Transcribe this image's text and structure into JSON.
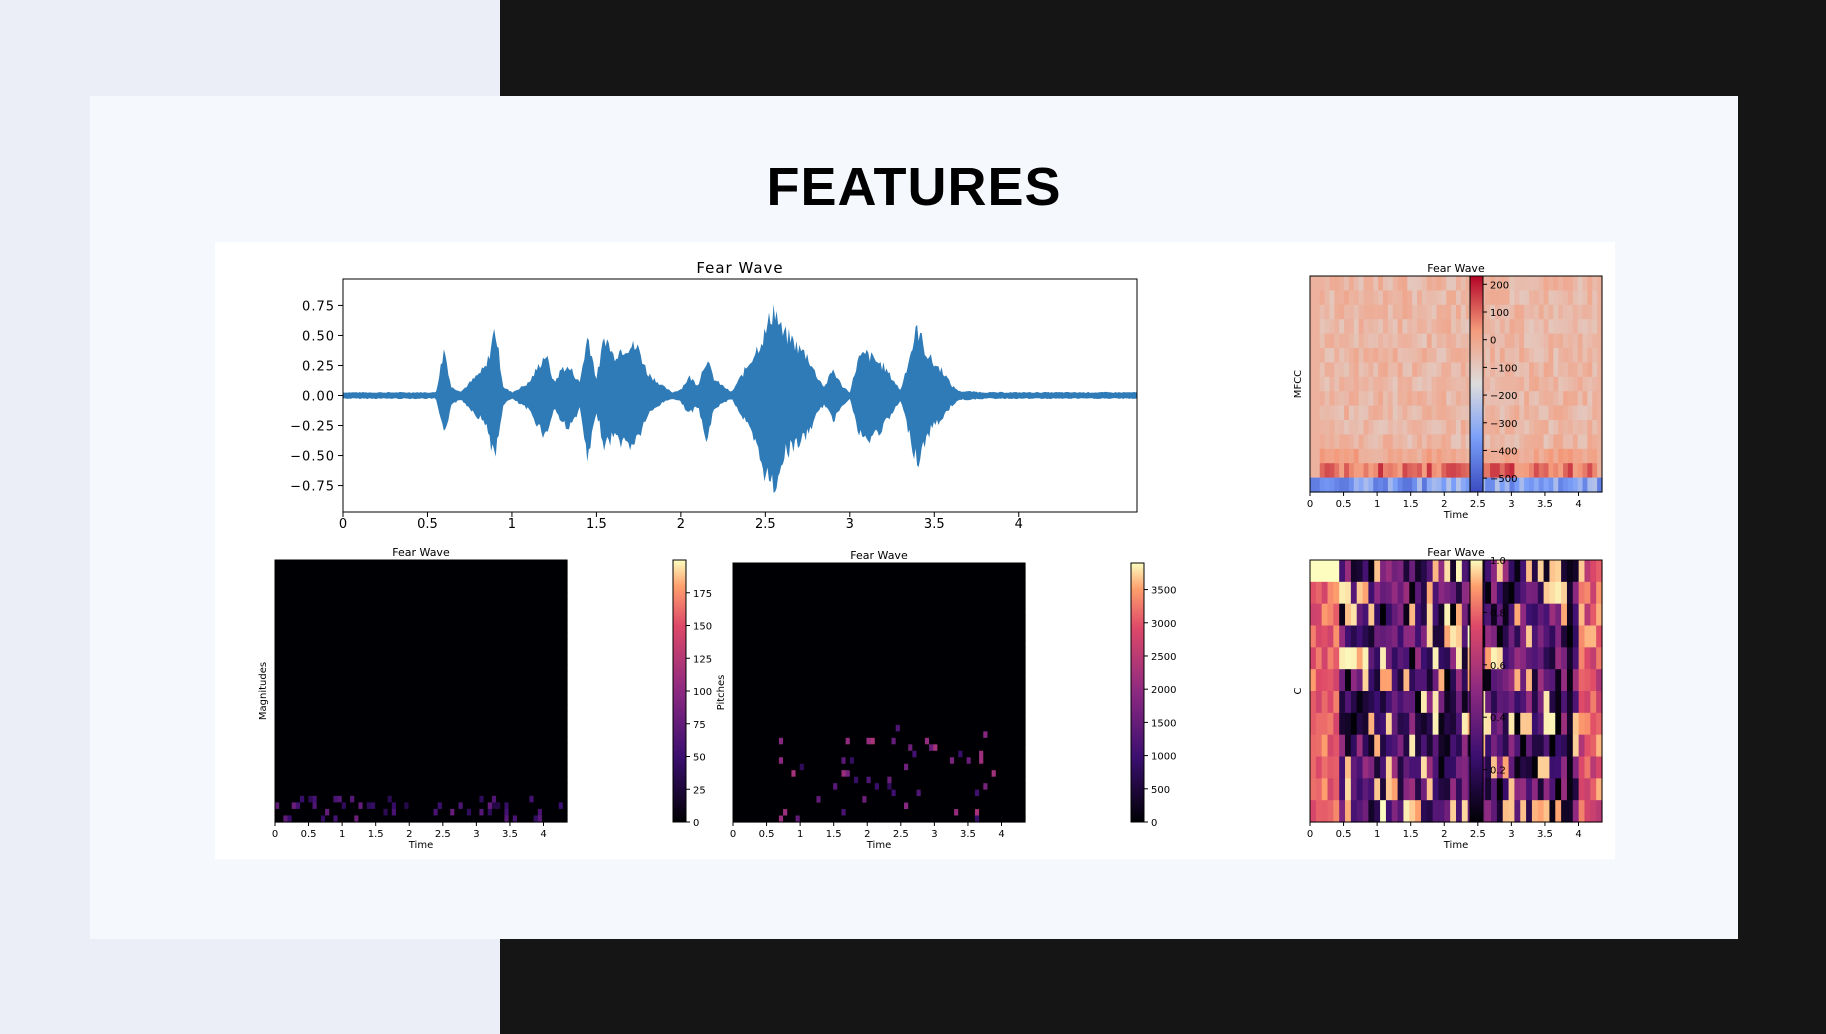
{
  "slide": {
    "title": "FEATURES"
  },
  "colors": {
    "waveform": "#2f7bb7",
    "axes": "#000000",
    "background": "#ffffff"
  },
  "chart_data": [
    {
      "id": "waveform",
      "type": "line",
      "title": "Fear Wave",
      "xlabel": "",
      "ylabel": "",
      "xlim": [
        0,
        4.7
      ],
      "ylim": [
        -0.97,
        0.97
      ],
      "yticks": [
        0.75,
        0.5,
        0.25,
        0.0,
        -0.25,
        -0.5,
        -0.75
      ],
      "ytick_labels": [
        "0.75",
        "0.50",
        "0.25",
        "0.00",
        "−0.25",
        "−0.50",
        "−0.75"
      ],
      "xticks": [
        0,
        0.5,
        1,
        1.5,
        2,
        2.5,
        3,
        3.5,
        4
      ],
      "xtick_labels": [
        "0",
        "0.5",
        "1",
        "1.5",
        "2",
        "2.5",
        "3",
        "3.5",
        "4"
      ],
      "grid": false,
      "envelope": {
        "t": [
          0.0,
          0.55,
          0.6,
          0.64,
          0.7,
          0.85,
          0.9,
          0.95,
          1.0,
          1.1,
          1.2,
          1.25,
          1.3,
          1.35,
          1.4,
          1.45,
          1.5,
          1.55,
          1.6,
          1.65,
          1.7,
          1.75,
          1.8,
          1.85,
          1.9,
          1.95,
          2.0,
          2.05,
          2.1,
          2.15,
          2.2,
          2.3,
          2.4,
          2.5,
          2.55,
          2.6,
          2.65,
          2.7,
          2.75,
          2.8,
          2.85,
          2.9,
          2.95,
          3.0,
          3.05,
          3.1,
          3.2,
          3.3,
          3.4,
          3.45,
          3.5,
          3.55,
          3.6,
          3.65,
          3.7,
          3.8,
          3.9,
          4.0,
          4.1,
          4.7
        ],
        "upper": [
          0.03,
          0.03,
          0.46,
          0.08,
          0.04,
          0.28,
          0.65,
          0.08,
          0.03,
          0.12,
          0.4,
          0.12,
          0.27,
          0.25,
          0.12,
          0.58,
          0.16,
          0.58,
          0.38,
          0.45,
          0.48,
          0.45,
          0.22,
          0.15,
          0.08,
          0.03,
          0.06,
          0.18,
          0.1,
          0.35,
          0.15,
          0.03,
          0.3,
          0.6,
          0.85,
          0.6,
          0.55,
          0.45,
          0.38,
          0.2,
          0.08,
          0.25,
          0.1,
          0.03,
          0.35,
          0.4,
          0.28,
          0.05,
          0.65,
          0.42,
          0.3,
          0.24,
          0.1,
          0.04,
          0.04,
          0.03,
          0.03,
          0.03,
          0.03,
          0.03
        ],
        "lower": [
          -0.03,
          -0.03,
          -0.42,
          -0.08,
          -0.04,
          -0.28,
          -0.63,
          -0.08,
          -0.03,
          -0.14,
          -0.4,
          -0.12,
          -0.27,
          -0.3,
          -0.12,
          -0.65,
          -0.16,
          -0.5,
          -0.38,
          -0.45,
          -0.48,
          -0.4,
          -0.2,
          -0.12,
          -0.06,
          -0.03,
          -0.06,
          -0.18,
          -0.1,
          -0.45,
          -0.12,
          -0.03,
          -0.3,
          -0.75,
          -0.9,
          -0.6,
          -0.5,
          -0.45,
          -0.38,
          -0.2,
          -0.08,
          -0.25,
          -0.1,
          -0.03,
          -0.35,
          -0.45,
          -0.3,
          -0.05,
          -0.65,
          -0.42,
          -0.28,
          -0.22,
          -0.1,
          -0.04,
          -0.04,
          -0.03,
          -0.03,
          -0.03,
          -0.03,
          -0.03
        ]
      }
    },
    {
      "id": "mfcc",
      "type": "heatmap",
      "title": "Fear Wave",
      "xlabel": "Time",
      "ylabel": "MFCC",
      "xlim": [
        0,
        4.35
      ],
      "xticks": [
        0,
        0.5,
        1,
        1.5,
        2,
        2.5,
        3,
        3.5,
        4
      ],
      "xtick_labels": [
        "0",
        "0.5",
        "1",
        "1.5",
        "2",
        "2.5",
        "3",
        "3.5",
        "4"
      ],
      "colormap": "coolwarm",
      "colorbar": {
        "min": -550,
        "max": 230,
        "ticks": [
          200,
          100,
          0,
          -100,
          -200,
          -300,
          -400,
          -500
        ],
        "tick_labels": [
          "200",
          "100",
          "0",
          "−100",
          "−200",
          "−300",
          "−400",
          "−500"
        ]
      }
    },
    {
      "id": "magnitudes",
      "type": "heatmap",
      "title": "Fear Wave",
      "xlabel": "Time",
      "ylabel": "Magnitudes",
      "xlim": [
        0,
        4.35
      ],
      "xticks": [
        0,
        0.5,
        1,
        1.5,
        2,
        2.5,
        3,
        3.5,
        4
      ],
      "xtick_labels": [
        "0",
        "0.5",
        "1",
        "1.5",
        "2",
        "2.5",
        "3",
        "3.5",
        "4"
      ],
      "colormap": "magma",
      "colorbar": {
        "min": 0,
        "max": 200,
        "ticks": [
          175,
          150,
          125,
          100,
          75,
          50,
          25,
          0
        ],
        "tick_labels": [
          "175",
          "150",
          "125",
          "100",
          "75",
          "50",
          "25",
          "0"
        ]
      }
    },
    {
      "id": "pitches",
      "type": "heatmap",
      "title": "Fear Wave",
      "xlabel": "Time",
      "ylabel": "Pitches",
      "xlim": [
        0,
        4.35
      ],
      "xticks": [
        0,
        0.5,
        1,
        1.5,
        2,
        2.5,
        3,
        3.5,
        4
      ],
      "xtick_labels": [
        "0",
        "0.5",
        "1",
        "1.5",
        "2",
        "2.5",
        "3",
        "3.5",
        "4"
      ],
      "colormap": "magma",
      "colorbar": {
        "min": 0,
        "max": 3900,
        "ticks": [
          3500,
          3000,
          2500,
          2000,
          1500,
          1000,
          500,
          0
        ],
        "tick_labels": [
          "3500",
          "3000",
          "2500",
          "2000",
          "1500",
          "1000",
          "500",
          "0"
        ]
      }
    },
    {
      "id": "chroma",
      "type": "heatmap",
      "title": "Fear Wave",
      "xlabel": "Time",
      "ylabel": "C",
      "xlim": [
        0,
        4.35
      ],
      "xticks": [
        0,
        0.5,
        1,
        1.5,
        2,
        2.5,
        3,
        3.5,
        4
      ],
      "xtick_labels": [
        "0",
        "0.5",
        "1",
        "1.5",
        "2",
        "2.5",
        "3",
        "3.5",
        "4"
      ],
      "colormap": "magma",
      "colorbar": {
        "min": 0,
        "max": 1.0,
        "ticks": [
          1.0,
          0.8,
          0.6,
          0.4,
          0.2
        ],
        "tick_labels": [
          "1.0",
          "0.8",
          "0.6",
          "0.4",
          "0.2"
        ]
      }
    }
  ]
}
